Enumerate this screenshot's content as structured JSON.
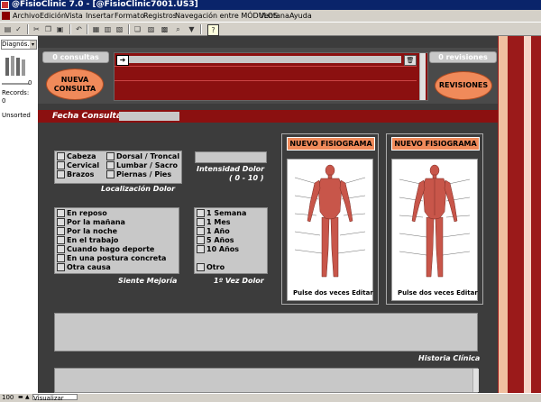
{
  "window": {
    "title": "@FisioClinic 7.0 - [@FisioClinic7001.US3]"
  },
  "menu": [
    "Archivo",
    "Edición",
    "Vista",
    "Insertar",
    "Formato",
    "Registros",
    "Navegación entre MÓDULOS",
    "Ventana",
    "Ayuda"
  ],
  "left_panel": {
    "view_select": "Diagnós...",
    "records_label": "Records:",
    "records_count": "0",
    "slider_value": "0",
    "sort_label": "Unsorted"
  },
  "header": {
    "consultas_label": "0 consultas",
    "revisiones_label": "0 revisiones",
    "nueva_consulta": "NUEVA\nCONSULTA",
    "revisiones_button": "REVISIONES",
    "fecha_label": "Fecha Consulta",
    "fecha_value": ""
  },
  "localizacion": {
    "col1": [
      "Cabeza",
      "Cervical",
      "Brazos"
    ],
    "col2": [
      "Dorsal / Troncal",
      "Lumbar / Sacro",
      "Piernas / Pies"
    ],
    "caption": "Localización Dolor"
  },
  "intensidad": {
    "caption_line1": "Intensidad Dolor",
    "caption_line2": "( 0 - 10 )",
    "value": ""
  },
  "mejoria": {
    "items": [
      "En reposo",
      "Por la mañana",
      "Por la noche",
      "En el trabajo",
      "Cuando hago deporte",
      "En una postura concreta",
      "Otra causa"
    ],
    "caption": "Siente Mejoría"
  },
  "primera_vez": {
    "items": [
      "1 Semana",
      "1 Mes",
      "1 Año",
      "5 Años",
      "10 Años"
    ],
    "otro": "Otro",
    "caption": "1º Vez Dolor"
  },
  "fisiogramas": {
    "button_label": "NUEVO FISIOGRAMA",
    "pulse_label": "Pulse dos veces Editar"
  },
  "historia": {
    "caption": "Historia Clínica",
    "value": ""
  },
  "statusbar": {
    "zoom": "100",
    "view_mode": "Visualizar"
  },
  "colors": {
    "title_bar": "#0a246a",
    "dark_red": "#8b1010",
    "orange": "#f08a5a",
    "main_bg": "#3c3c3c"
  },
  "icons": [
    "app-icon",
    "print-icon",
    "cut-icon",
    "copy-icon",
    "paste-icon",
    "undo-icon",
    "help-icon",
    "arrow-right-icon",
    "trash-icon"
  ]
}
